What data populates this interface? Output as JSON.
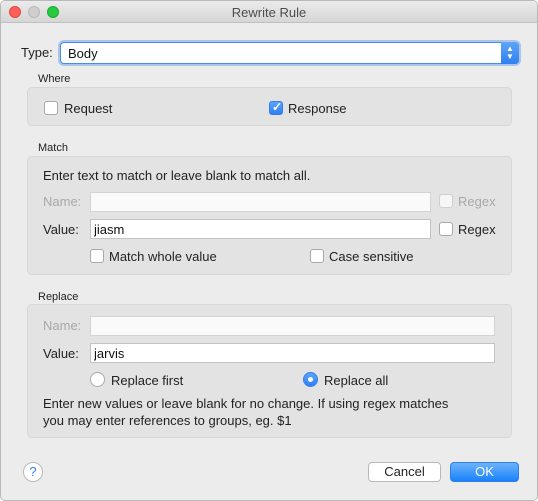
{
  "window": {
    "title": "Rewrite Rule"
  },
  "type": {
    "label": "Type:",
    "value": "Body"
  },
  "where": {
    "section_title": "Where",
    "request": {
      "label": "Request",
      "checked": false
    },
    "response": {
      "label": "Response",
      "checked": true
    }
  },
  "match": {
    "section_title": "Match",
    "hint": "Enter text to match or leave blank to match all.",
    "name": {
      "label": "Name:",
      "value": "",
      "regex_label": "Regex",
      "enabled": false
    },
    "value": {
      "label": "Value:",
      "value": "jiasm",
      "regex_label": "Regex",
      "regex_checked": false
    },
    "match_whole_value": {
      "label": "Match whole value",
      "checked": false
    },
    "case_sensitive": {
      "label": "Case sensitive",
      "checked": false
    }
  },
  "replace": {
    "section_title": "Replace",
    "name": {
      "label": "Name:",
      "value": "",
      "enabled": false
    },
    "value": {
      "label": "Value:",
      "value": "jarvis"
    },
    "replace_first": {
      "label": "Replace first",
      "selected": false
    },
    "replace_all": {
      "label": "Replace all",
      "selected": true
    },
    "hint_line1": "Enter new values or leave blank for no change. If using regex matches",
    "hint_line2": "you may enter references to groups, eg. $1"
  },
  "footer": {
    "help_label": "?",
    "cancel_label": "Cancel",
    "ok_label": "OK"
  }
}
